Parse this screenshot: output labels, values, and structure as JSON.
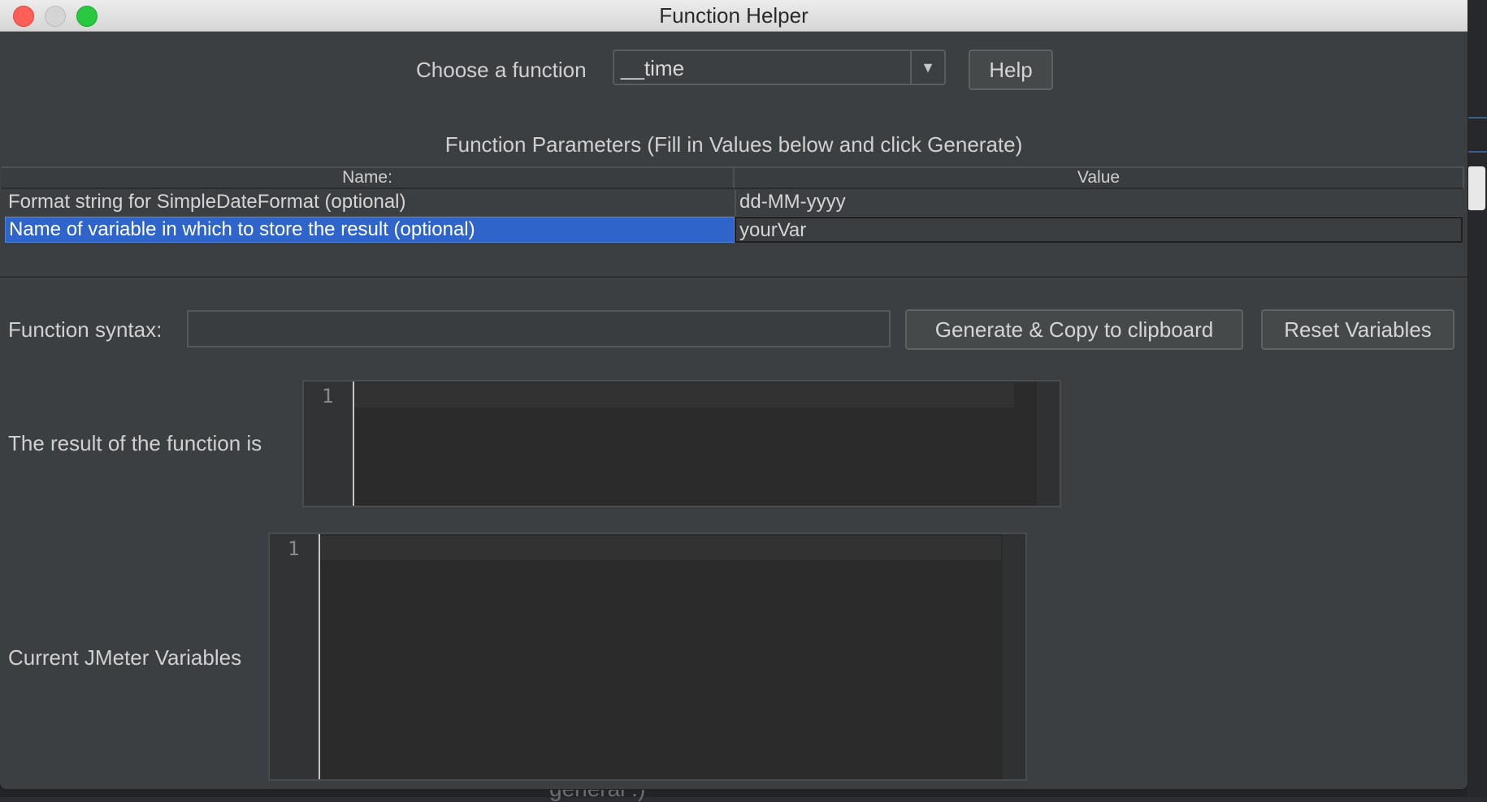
{
  "window": {
    "title": "Function Helper"
  },
  "function_chooser": {
    "label": "Choose a function",
    "selected": "__time",
    "help_label": "Help"
  },
  "parameters": {
    "heading": "Function Parameters (Fill in Values below and click Generate)",
    "columns": [
      "Name:",
      "Value"
    ],
    "rows": [
      {
        "name": "Format string for SimpleDateFormat (optional)",
        "value": "dd-MM-yyyy",
        "selected": false
      },
      {
        "name": "Name of variable in which to store the result (optional)",
        "value": "yourVar",
        "selected": true
      }
    ]
  },
  "syntax": {
    "label": "Function syntax:",
    "value": "",
    "generate_label": "Generate & Copy to clipboard",
    "reset_label": "Reset Variables"
  },
  "result": {
    "label": "The result of the function is",
    "line_number": "1"
  },
  "variables": {
    "label": "Current JMeter Variables",
    "line_number": "1"
  },
  "background": {
    "partial_text": "general :)"
  }
}
